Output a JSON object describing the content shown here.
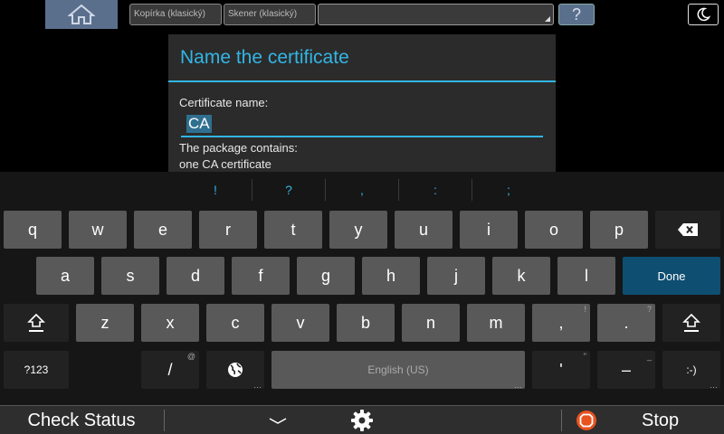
{
  "topbar": {
    "tabs": [
      "Kopírka (klasický)",
      "Skener (klasický)"
    ],
    "field_value": "",
    "help_label": "?",
    "icons": [
      "home-icon",
      "moon-icon"
    ]
  },
  "dialog": {
    "title": "Name the certificate",
    "name_label": "Certificate name:",
    "name_value": "CA",
    "info_line1": "The package contains:",
    "info_line2": "one CA certificate",
    "accent_color": "#33b5e5"
  },
  "keyboard": {
    "suggestions": [
      "!",
      "?",
      ",",
      ":",
      ";"
    ],
    "row1": [
      "q",
      "w",
      "e",
      "r",
      "t",
      "y",
      "u",
      "i",
      "o",
      "p"
    ],
    "row2": [
      "a",
      "s",
      "d",
      "f",
      "g",
      "h",
      "j",
      "k",
      "l"
    ],
    "row3": [
      "z",
      "x",
      "c",
      "v",
      "b",
      "n",
      "m",
      ",",
      "."
    ],
    "row3_hints": [
      "!",
      "?"
    ],
    "done_label": "Done",
    "symbols_label": "?123",
    "slash_label": "/",
    "slash_hint": "@",
    "space_label": "English (US)",
    "apostrophe_label": "'",
    "apostrophe_hint": "\"",
    "dash_label": "–",
    "dash_hint": "_",
    "smiley_label": ":-)",
    "done_color": "#0e4e71"
  },
  "bottombar": {
    "check_status": "Check Status",
    "stop": "Stop",
    "icons": [
      "chevron-down-icon",
      "gear-icon",
      "stop-icon"
    ]
  }
}
